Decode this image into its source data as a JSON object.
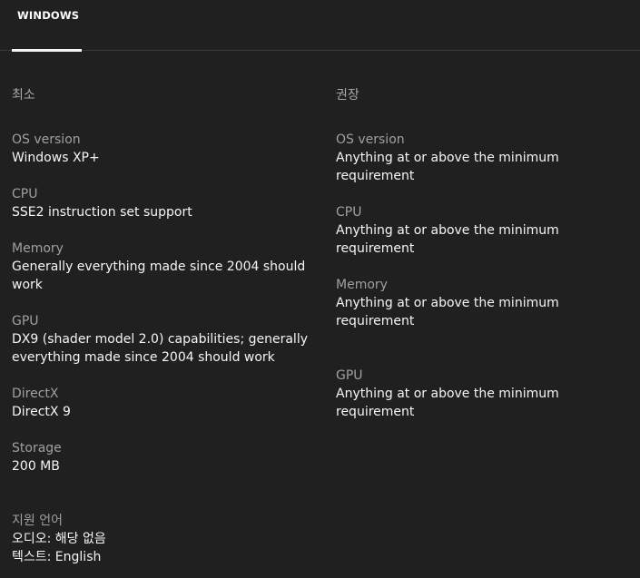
{
  "tabs": [
    {
      "label": "WINDOWS",
      "active": true
    }
  ],
  "minimum": {
    "heading": "최소",
    "specs": [
      {
        "label": "OS version",
        "value": "Windows XP+"
      },
      {
        "label": "CPU",
        "value": "SSE2 instruction set support"
      },
      {
        "label": "Memory",
        "value": "Generally everything made since 2004 should work"
      },
      {
        "label": "GPU",
        "value": "DX9 (shader model 2.0) capabilities; generally everything made since 2004 should work"
      },
      {
        "label": "DirectX",
        "value": "DirectX 9"
      },
      {
        "label": "Storage",
        "value": "200 MB"
      }
    ]
  },
  "recommended": {
    "heading": "권장",
    "specs": [
      {
        "label": "OS version",
        "value": "Anything at or above the minimum requirement"
      },
      {
        "label": "CPU",
        "value": "Anything at or above the minimum requirement"
      },
      {
        "label": "Memory",
        "value": "Anything at or above the minimum requirement"
      },
      {
        "label": "GPU",
        "value": "Anything at or above the minimum requirement"
      }
    ]
  },
  "languages": {
    "heading": "지원 언어",
    "audio": "오디오: 해당 없음",
    "text": "텍스트: English"
  }
}
